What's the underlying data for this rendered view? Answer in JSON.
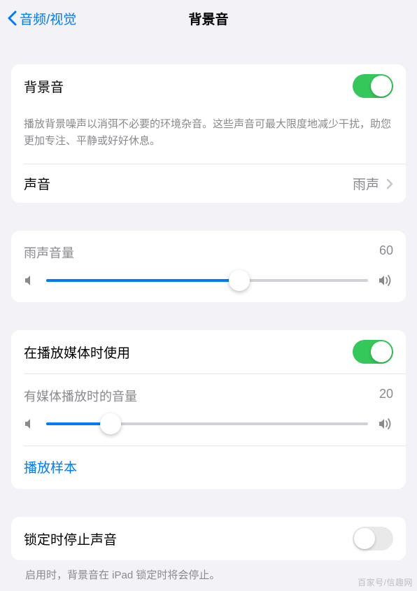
{
  "header": {
    "back_label": "音频/视觉",
    "title": "背景音"
  },
  "main_toggle": {
    "label": "背景音",
    "state": "on",
    "description": "播放背景噪声以消弭不必要的环境杂音。这些声音可最大限度地减少干扰，助您更加专注、平静或好好休息。"
  },
  "sound_row": {
    "label": "声音",
    "value": "雨声"
  },
  "volume1": {
    "label": "雨声音量",
    "value": "60",
    "percent": 60
  },
  "media_toggle": {
    "label": "在播放媒体时使用",
    "state": "on"
  },
  "volume2": {
    "label": "有媒体播放时的音量",
    "value": "20",
    "percent": 20
  },
  "sample_link": "播放样本",
  "lock_toggle": {
    "label": "锁定时停止声音",
    "state": "off",
    "description": "启用时，背景音在 iPad 锁定时将会停止。"
  },
  "watermark": "百家号/信趣网"
}
